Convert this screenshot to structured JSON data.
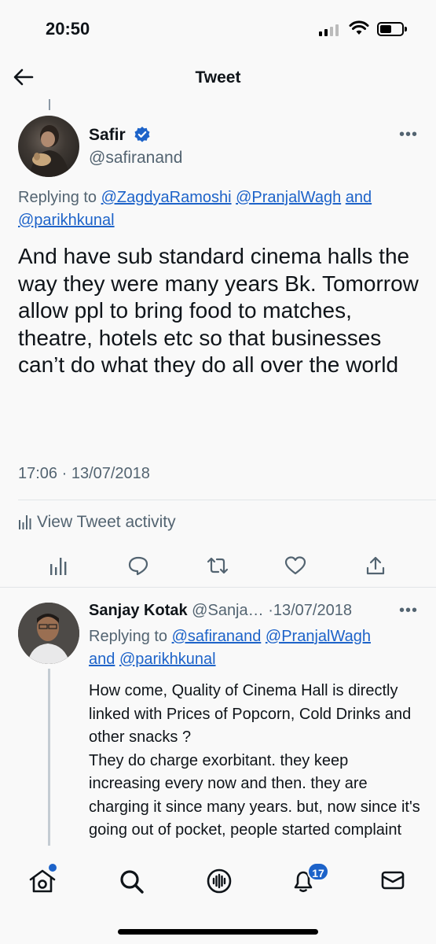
{
  "status_bar": {
    "time": "20:50"
  },
  "header": {
    "title": "Tweet"
  },
  "main_tweet": {
    "author_name": "Safir",
    "author_handle": "@safiranand",
    "replying_prefix": "Replying to",
    "replying_to": [
      "@ZagdyaRamoshi",
      "@PranjalWagh"
    ],
    "replying_and": "and",
    "replying_last": "@parikhkunal",
    "text": "And have sub standard cinema halls the way they were many years Bk. Tomorrow allow ppl to bring food to matches, theatre, hotels etc so that businesses can’t do what they do all over the world",
    "timestamp": "17:06 · 13/07/2018",
    "activity_label": "View Tweet activity",
    "actions": [
      "analytics-icon",
      "reply-icon",
      "retweet-icon",
      "like-icon",
      "share-icon"
    ]
  },
  "reply_tweet": {
    "author_name": "Sanjay Kotak",
    "author_handle": "@Sanja…",
    "separator": "·",
    "date": "13/07/2018",
    "replying_prefix": "Replying to",
    "replying_to": [
      "@safiranand",
      "@PranjalWagh"
    ],
    "replying_and": "and",
    "replying_last": "@parikhkunal",
    "text": "How come, Quality of Cinema Hall is directly linked with Prices of Popcorn, Cold Drinks and other snacks ?\nThey do charge exorbitant. they keep increasing every now and then. they are charging it since many years. but, now since it's going out of pocket, people started complaint"
  },
  "bottom_nav": {
    "items": [
      "home-icon",
      "search-icon",
      "spaces-icon",
      "notifications-icon",
      "messages-icon"
    ],
    "notification_count": "17"
  },
  "colors": {
    "link": "#1d63c9",
    "secondary_text": "#536471",
    "accent": "#1d63c9"
  }
}
